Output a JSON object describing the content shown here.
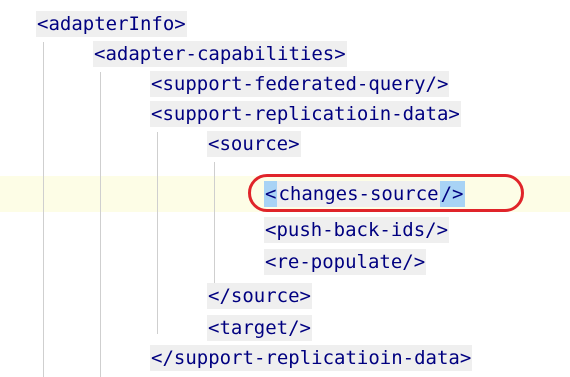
{
  "editor": {
    "lines": [
      {
        "text": "<adapterInfo>"
      },
      {
        "text": "<adapter-capabilities>"
      },
      {
        "text": "<support-federated-query/>"
      },
      {
        "text": "<support-replicatioin-data>"
      },
      {
        "text": "<source>"
      },
      {
        "open": "<",
        "text": "changes-source",
        "close": "/>"
      },
      {
        "text": "<push-back-ids/>"
      },
      {
        "text": "<re-populate/>"
      },
      {
        "text": "</source>"
      },
      {
        "text": "<target/>"
      },
      {
        "text": "</support-replicatioin-data>"
      }
    ],
    "highlight_color": "#e0242a",
    "current_line_color": "#fdfde6",
    "bracket_match_color": "#a8d3f5"
  }
}
